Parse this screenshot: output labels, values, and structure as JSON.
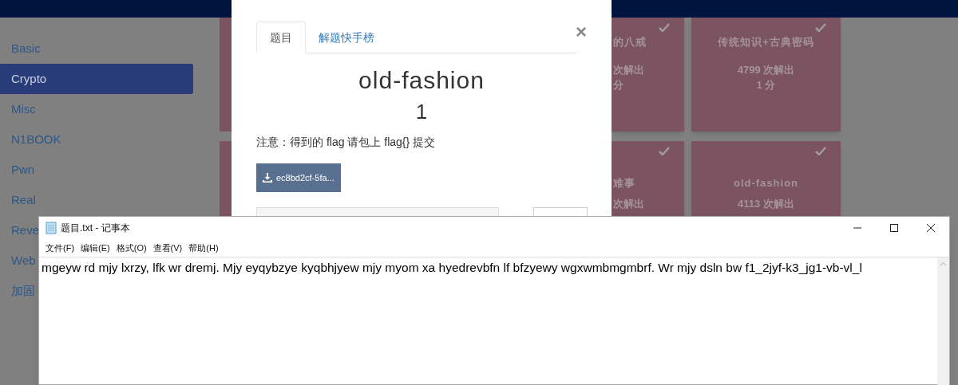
{
  "sidebar": {
    "items": [
      {
        "label": "Basic",
        "selected": false
      },
      {
        "label": "Crypto",
        "selected": true
      },
      {
        "label": "Misc",
        "selected": false
      },
      {
        "label": "N1BOOK",
        "selected": false
      },
      {
        "label": "Pwn",
        "selected": false
      },
      {
        "label": "Real",
        "selected": false
      },
      {
        "label": "Reve",
        "selected": false
      },
      {
        "label": "Web",
        "selected": false
      },
      {
        "label": "加固",
        "selected": false
      }
    ]
  },
  "cards": [
    {
      "title": "的八戒",
      "solves": "次解出",
      "points": "分",
      "solved": true
    },
    {
      "title": "传统知识+古典密码",
      "solves": "4799 次解出",
      "points": "1 分",
      "solved": true
    },
    {
      "title": "难事",
      "solves": "次解出",
      "solved": true
    },
    {
      "title": "old-fashion",
      "solves": "4113 次解出",
      "solved": true
    }
  ],
  "modal": {
    "tabs": [
      {
        "label": "题目",
        "selected": true
      },
      {
        "label": "解题快手榜",
        "selected": false
      }
    ],
    "close": "×",
    "title": "old-fashion",
    "score": "1",
    "note": "注意：得到的 flag 请包上 flag{} 提交",
    "download": "ec8bd2cf-5fa..."
  },
  "notepad": {
    "title": "题目.txt - 记事本",
    "menu": [
      "文件(F)",
      "编辑(E)",
      "格式(O)",
      "查看(V)",
      "帮助(H)"
    ],
    "text": "mgeyw rd mjy lxrzy, lfk wr dremj. Mjy eyqybzye kyqbhjyew mjy myom xa hyedrevbfn lf bfzyewy wgxwmbmgmbrf. Wr mjy dsln bw f1_2jyf-k3_jg1-vb-vl_l"
  }
}
